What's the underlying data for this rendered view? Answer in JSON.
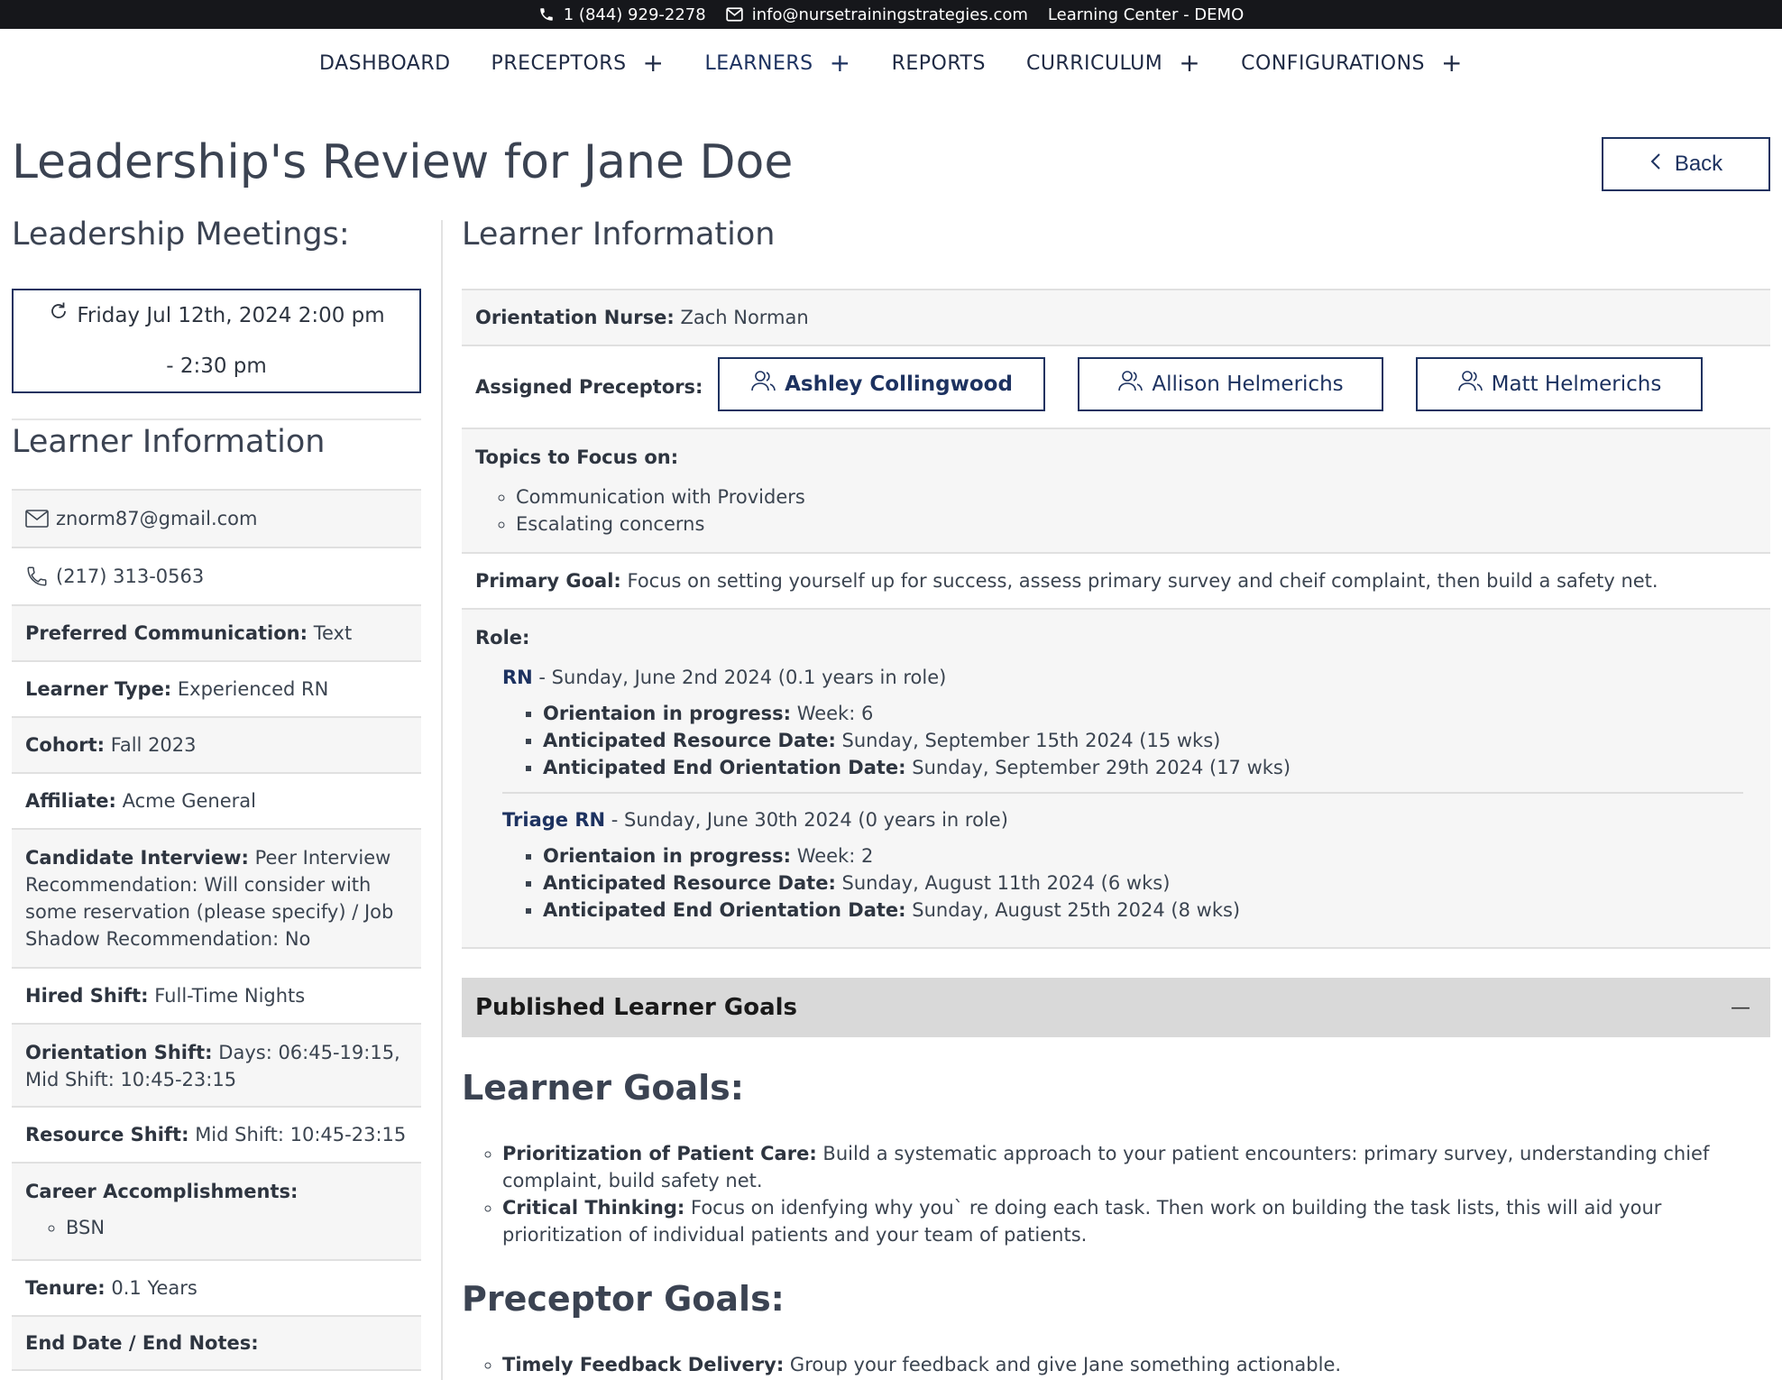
{
  "topbar": {
    "phone": "1 (844) 929-2278",
    "email": "info@nursetrainingstrategies.com",
    "site": "Learning Center - DEMO"
  },
  "nav": {
    "items": [
      {
        "label": "DASHBOARD"
      },
      {
        "label": "PRECEPTORS",
        "expand": "+"
      },
      {
        "label": "LEARNERS",
        "expand": "+"
      },
      {
        "label": "REPORTS"
      },
      {
        "label": "CURRICULUM",
        "expand": "+"
      },
      {
        "label": "CONFIGURATIONS",
        "expand": "+"
      }
    ]
  },
  "page": {
    "title": "Leadership's Review for Jane Doe",
    "back_label": "Back"
  },
  "meetings": {
    "title": "Leadership Meetings:",
    "line1": "Friday Jul 12th, 2024 2:00 pm",
    "line2": "- 2:30 pm"
  },
  "left_info": {
    "title": "Learner Information",
    "email": "znorm87@gmail.com",
    "phone": "(217) 313-0563",
    "preferred_comm": {
      "label": "Preferred Communication:",
      "value": "Text"
    },
    "learner_type": {
      "label": "Learner Type:",
      "value": "Experienced RN"
    },
    "cohort": {
      "label": "Cohort:",
      "value": "Fall 2023"
    },
    "affiliate": {
      "label": "Affiliate:",
      "value": "Acme General"
    },
    "candidate_interview": {
      "label": "Candidate Interview:",
      "value": "Peer Interview Recommendation: Will consider with some reservation (please specify) / Job Shadow Recommendation: No"
    },
    "hired_shift": {
      "label": "Hired Shift:",
      "value": "Full-Time Nights"
    },
    "orientation_shift": {
      "label": "Orientation Shift:",
      "value": "Days: 06:45-19:15, Mid Shift: 10:45-23:15"
    },
    "resource_shift": {
      "label": "Resource Shift:",
      "value": "Mid Shift: 10:45-23:15"
    },
    "career": {
      "label": "Career Accomplishments:",
      "items": [
        "BSN"
      ]
    },
    "tenure": {
      "label": "Tenure:",
      "value": "0.1 Years"
    },
    "end_date": {
      "label": "End Date / End Notes:"
    }
  },
  "right_info": {
    "title": "Learner Information",
    "orientation_nurse": {
      "label": "Orientation Nurse:",
      "value": "Zach Norman"
    },
    "preceptors_label": "Assigned Preceptors:",
    "preceptors": [
      "Ashley Collingwood",
      "Allison Helmerichs",
      "Matt Helmerichs"
    ],
    "topics_label": "Topics to Focus on:",
    "topics": [
      "Communication with Providers",
      "Escalating concerns"
    ],
    "primary_goal": {
      "label": "Primary Goal:",
      "value": "Focus on setting yourself up for success, assess primary survey and cheif complaint, then build a safety net."
    },
    "role_label": "Role:",
    "roles": [
      {
        "name": "RN",
        "detail": " - Sunday, June 2nd 2024 (0.1 years in role)",
        "items": [
          {
            "label": "Orientaion in progress:",
            "value": "Week: 6"
          },
          {
            "label": "Anticipated Resource Date:",
            "value": "Sunday, September 15th 2024 (15 wks)"
          },
          {
            "label": "Anticipated End Orientation Date:",
            "value": "Sunday, September 29th 2024 (17 wks)"
          }
        ]
      },
      {
        "name": "Triage RN",
        "detail": " - Sunday, June 30th 2024 (0 years in role)",
        "items": [
          {
            "label": "Orientaion in progress:",
            "value": "Week: 2"
          },
          {
            "label": "Anticipated Resource Date:",
            "value": "Sunday, August 11th 2024 (6 wks)"
          },
          {
            "label": "Anticipated End Orientation Date:",
            "value": "Sunday, August 25th 2024 (8 wks)"
          }
        ]
      }
    ]
  },
  "published": {
    "title": "Published Learner Goals",
    "collapse_icon": "—",
    "learner_goals_title": "Learner Goals:",
    "learner_goals": [
      {
        "label": "Prioritization of Patient Care:",
        "value": "Build a systematic approach to your patient encounters: primary survey, understanding chief complaint, build safety net."
      },
      {
        "label": "Critical Thinking:",
        "value": "Focus on idenfying why you` re doing each task. Then work on building the task lists, this will aid your prioritization of individual patients and your team of patients."
      }
    ],
    "preceptor_goals_title": "Preceptor Goals:",
    "preceptor_goals": [
      {
        "label": "Timely Feedback Delivery:",
        "value": "Group your feedback and give Jane something actionable."
      }
    ]
  }
}
